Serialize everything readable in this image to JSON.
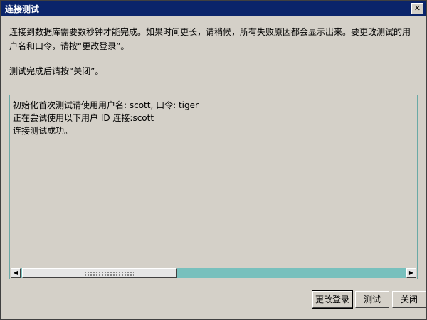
{
  "window": {
    "title": "连接测试",
    "close_symbol": "✕"
  },
  "description": "连接到数据库需要数秒钟才能完成。如果时间更长，请稍候，所有失败原因都会显示出来。要更改测试的用户名和口令，请按“更改登录”。",
  "hint": "测试完成后请按“关闭”。",
  "output": {
    "lines": [
      "初始化首次测试请使用用户名: scott, 口令: tiger",
      "正在尝试使用以下用户 ID 连接:scott",
      "连接测试成功。"
    ]
  },
  "scrollbar": {
    "left_arrow": "◀",
    "right_arrow": "▶"
  },
  "buttons": {
    "change_login": "更改登录",
    "test": "测试",
    "close": "关闭"
  }
}
